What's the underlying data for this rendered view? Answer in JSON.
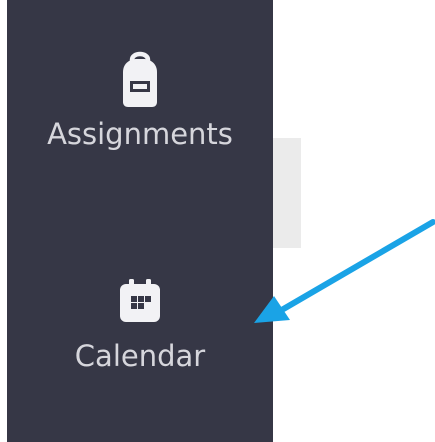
{
  "sidebar": {
    "items": [
      {
        "label": "Assignments",
        "icon": "backpack-icon"
      },
      {
        "label": "Calendar",
        "icon": "calendar-icon"
      }
    ]
  },
  "colors": {
    "sidebar_bg": "#363746",
    "label_text": "#d6d6dc",
    "icon_fill": "#f2f2f5",
    "arrow": "#1aa3e6",
    "content_panel": "#ebebeb"
  }
}
